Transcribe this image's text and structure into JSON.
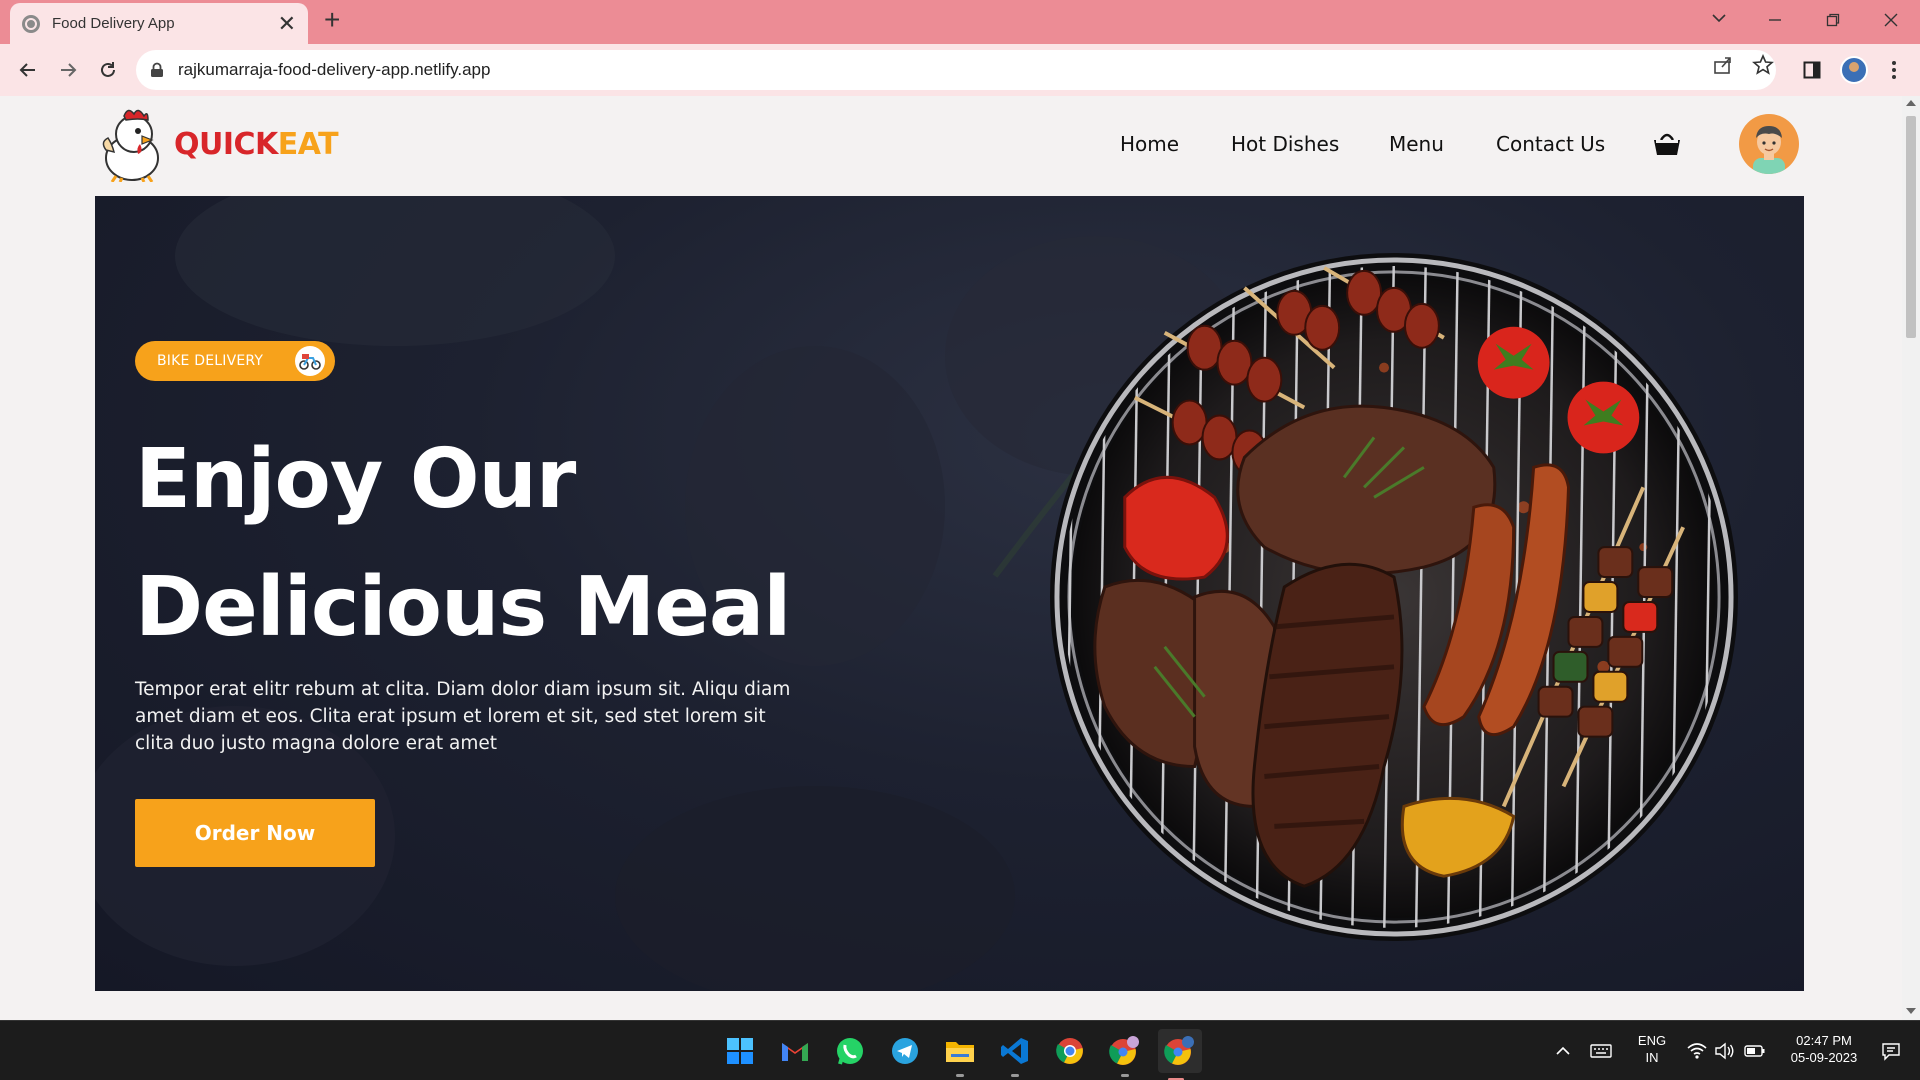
{
  "browser": {
    "tab_title": "Food Delivery App",
    "tab_close": "✕",
    "new_tab": "+",
    "url": "rajkumarraja-food-delivery-app.netlify.app"
  },
  "site": {
    "brand_quick": "QUICK",
    "brand_eat": "EAT",
    "nav": [
      "Home",
      "Hot Dishes",
      "Menu",
      "Contact Us"
    ]
  },
  "hero": {
    "badge": "BIKE DELIVERY",
    "headline_line1": "Enjoy Our",
    "headline_line2": "Delicious Meal",
    "description": "Tempor erat elitr rebum at clita. Diam dolor diam ipsum sit. Aliqu diam amet diam et eos. Clita erat ipsum et lorem et sit, sed stet lorem sit clita duo justo magna dolore erat amet",
    "button": "Order Now"
  },
  "taskbar": {
    "apps": [
      "windows-start",
      "gmail",
      "whatsapp",
      "telegram",
      "file-explorer",
      "vscode",
      "chrome",
      "chrome-profile",
      "chrome-active"
    ],
    "lang_line1": "ENG",
    "lang_line2": "IN",
    "time": "02:47 PM",
    "date": "05-09-2023"
  },
  "colors": {
    "titlebar": "#ec8c95",
    "toolbar": "#fbe4e6",
    "accent_orange": "#f7a21b",
    "brand_red": "#d8262a",
    "hero_bg": "#1d2130"
  }
}
